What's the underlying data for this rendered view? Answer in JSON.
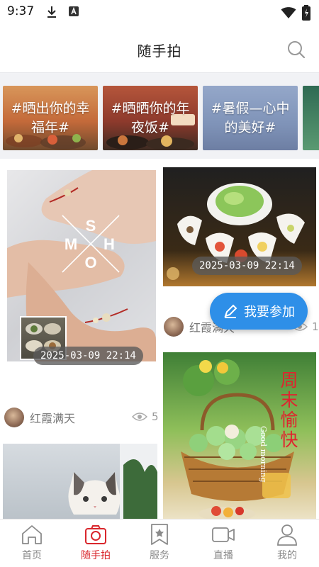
{
  "status_bar": {
    "time": "9:37"
  },
  "header": {
    "title": "随手拍"
  },
  "topics": [
    {
      "label": "#晒出你的幸福年#"
    },
    {
      "label": "#晒晒你的年夜饭#"
    },
    {
      "label": "#暑假—心中的美好#"
    }
  ],
  "feed": {
    "left": [
      {
        "stamp": "2025-03-09  22:14",
        "watermark": "SHMO",
        "author": "红霞满天",
        "views": "5"
      }
    ],
    "right": [
      {
        "stamp": "2025-03-09  22:14",
        "author": "红霞满天",
        "views": "1"
      },
      {
        "overlay_text": "周末愉快",
        "overlay_sub": "Good morning"
      }
    ]
  },
  "join_button": {
    "label": "我要参加"
  },
  "nav": [
    {
      "label": "首页",
      "icon": "home-icon"
    },
    {
      "label": "随手拍",
      "icon": "camera-icon",
      "active": true
    },
    {
      "label": "服务",
      "icon": "bookmark-star-icon"
    },
    {
      "label": "直播",
      "icon": "video-icon"
    },
    {
      "label": "我的",
      "icon": "user-icon"
    }
  ],
  "colors": {
    "accent_red": "#d9262c",
    "join_blue": "#2e8fe8"
  }
}
